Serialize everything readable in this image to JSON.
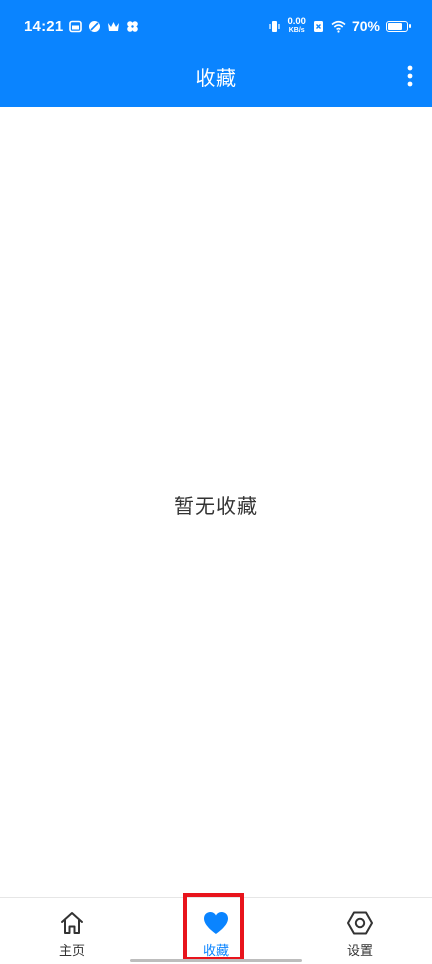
{
  "status_bar": {
    "time": "14:21",
    "net_speed_value": "0.00",
    "net_speed_unit": "KB/s",
    "battery_percent": "70%",
    "battery_level": 0.7,
    "icons": [
      "calendar-icon",
      "leaf-icon",
      "crown-icon",
      "fan-icon",
      "vibrate-icon",
      "sim-x-icon",
      "wifi-icon",
      "battery-icon"
    ]
  },
  "app_bar": {
    "title": "收藏",
    "menu_icon": "more-vertical-icon"
  },
  "content": {
    "empty_message": "暂无收藏"
  },
  "bottom_nav": {
    "items": [
      {
        "label": "主页",
        "icon": "home-icon",
        "active": false
      },
      {
        "label": "收藏",
        "icon": "heart-icon",
        "active": true
      },
      {
        "label": "设置",
        "icon": "settings-icon",
        "active": false
      }
    ]
  },
  "colors": {
    "primary": "#0a84ff",
    "highlight_box": "#e8141c",
    "text": "#333333"
  }
}
